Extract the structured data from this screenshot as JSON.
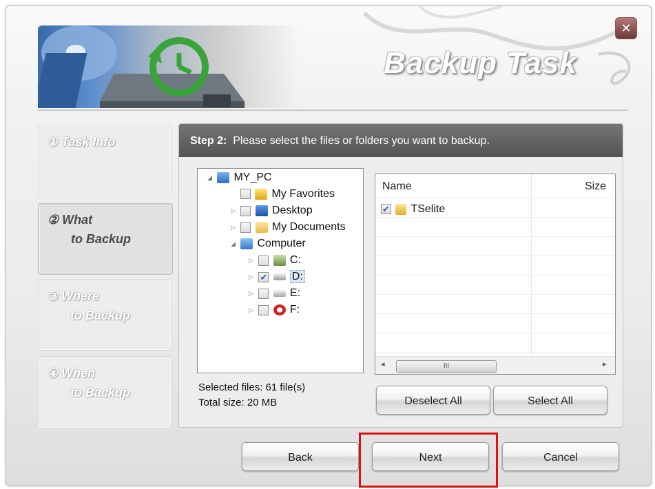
{
  "window": {
    "title": "Backup Task",
    "close_icon": "close-icon",
    "accent": "#757575",
    "highlight_color": "#e01010"
  },
  "steps": [
    {
      "number": "①",
      "line1": "Task Info",
      "line2": "",
      "state": "inactive"
    },
    {
      "number": "②",
      "line1": "What",
      "line2": "to Backup",
      "state": "active"
    },
    {
      "number": "③",
      "line1": "Where",
      "line2": "to Backup",
      "state": "inactive"
    },
    {
      "number": "④",
      "line1": "When",
      "line2": "to Backup",
      "state": "inactive"
    }
  ],
  "panel": {
    "step_prefix": "Step 2:",
    "instruction": "Please select the files or folders you want to backup."
  },
  "tree": {
    "root": "MY_PC",
    "items": [
      {
        "label": "My Favorites",
        "checked": false,
        "icon": "star-folder-icon"
      },
      {
        "label": "Desktop",
        "checked": false,
        "icon": "desktop-icon"
      },
      {
        "label": "My Documents",
        "checked": false,
        "icon": "documents-folder-icon"
      },
      {
        "label": "Computer",
        "icon": "computer-icon"
      },
      {
        "label": "C:",
        "checked": false,
        "icon": "system-drive-icon"
      },
      {
        "label": "D:",
        "checked": true,
        "icon": "hard-drive-icon"
      },
      {
        "label": "E:",
        "checked": false,
        "icon": "removable-drive-icon"
      },
      {
        "label": "F:",
        "checked": false,
        "icon": "special-drive-icon"
      }
    ]
  },
  "stats": {
    "selected_files": "Selected files: 61 file(s)",
    "total_size": "Total size: 20 MB"
  },
  "file_list": {
    "columns": [
      "Name",
      "Size"
    ],
    "rows": [
      {
        "name": "TSelite",
        "checked": true,
        "icon": "folder-icon"
      }
    ],
    "scroll_thumb": "III"
  },
  "buttons": {
    "deselect_all": "Deselect All",
    "select_all": "Select All",
    "back": "Back",
    "next": "Next",
    "cancel": "Cancel"
  }
}
